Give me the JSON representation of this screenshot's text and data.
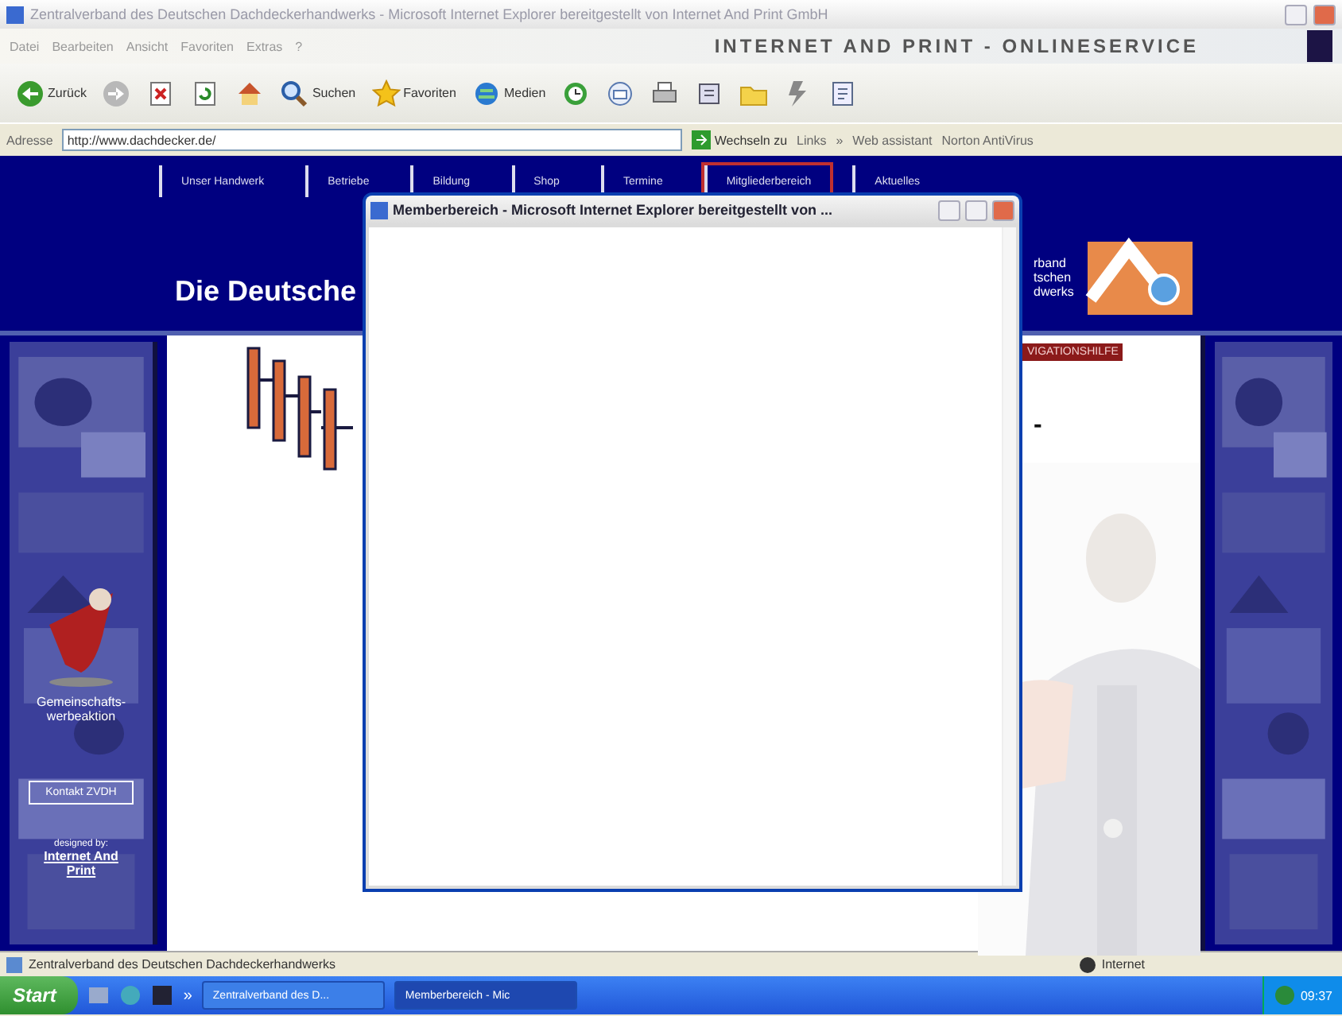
{
  "window": {
    "title": "Zentralverband des Deutschen Dachdeckerhandwerks - Microsoft Internet Explorer bereitgestellt von Internet And Print GmbH"
  },
  "menu": [
    "Datei",
    "Bearbeiten",
    "Ansicht",
    "Favoriten",
    "Extras",
    "?"
  ],
  "brand": "INTERNET AND PRINT - ONLINESERVICE",
  "toolbar": [
    {
      "kind": "back",
      "label": "Zurück"
    },
    {
      "kind": "forward"
    },
    {
      "kind": "stop"
    },
    {
      "kind": "refresh"
    },
    {
      "kind": "home"
    },
    {
      "kind": "search",
      "label": "Suchen"
    },
    {
      "kind": "favorites",
      "label": "Favoriten"
    },
    {
      "kind": "media",
      "label": "Medien"
    },
    {
      "kind": "history"
    },
    {
      "kind": "mail"
    },
    {
      "kind": "print"
    },
    {
      "kind": "edit"
    },
    {
      "kind": "folder"
    },
    {
      "kind": "messenger"
    },
    {
      "kind": "research"
    }
  ],
  "address": {
    "label": "Adresse",
    "value": "http://www.dachdecker.de/",
    "go": "Wechseln zu",
    "links": "Links",
    "more": "»",
    "assistant": "Web assistant",
    "antivirus": "Norton AntiVirus"
  },
  "site": {
    "nav": [
      {
        "label": "Unser Handwerk",
        "selected": false
      },
      {
        "label": "Betriebe",
        "selected": false
      },
      {
        "label": "Bildung",
        "selected": false
      },
      {
        "label": "Shop",
        "selected": false
      },
      {
        "label": "Termine",
        "selected": false
      },
      {
        "label": "Mitgliederbereich",
        "selected": true
      },
      {
        "label": "Aktuelles",
        "selected": false
      }
    ],
    "heading": "Die Deutsche",
    "org_lines": [
      "rband",
      "tschen",
      "dwerks"
    ],
    "navigation_help": "VIGATIONSHILFE",
    "dash": "-",
    "campaign": "Gemeinschafts-werbeaktion",
    "contact": "Kontakt ZVDH",
    "designed_by": "designed by:",
    "designer": "Internet And Print"
  },
  "popup": {
    "title": "Memberbereich - Microsoft Internet Explorer bereitgestellt von ..."
  },
  "status_bar": {
    "text": "Zentralverband des Deutschen Dachdeckerhandwerks",
    "zone": "Internet"
  },
  "taskbar": {
    "start": "Start",
    "more": "»",
    "tasks": [
      {
        "label": "Zentralverband des D...",
        "selected": false
      },
      {
        "label": "Memberbereich - Mic",
        "selected": true
      }
    ],
    "clock": "09:37"
  }
}
